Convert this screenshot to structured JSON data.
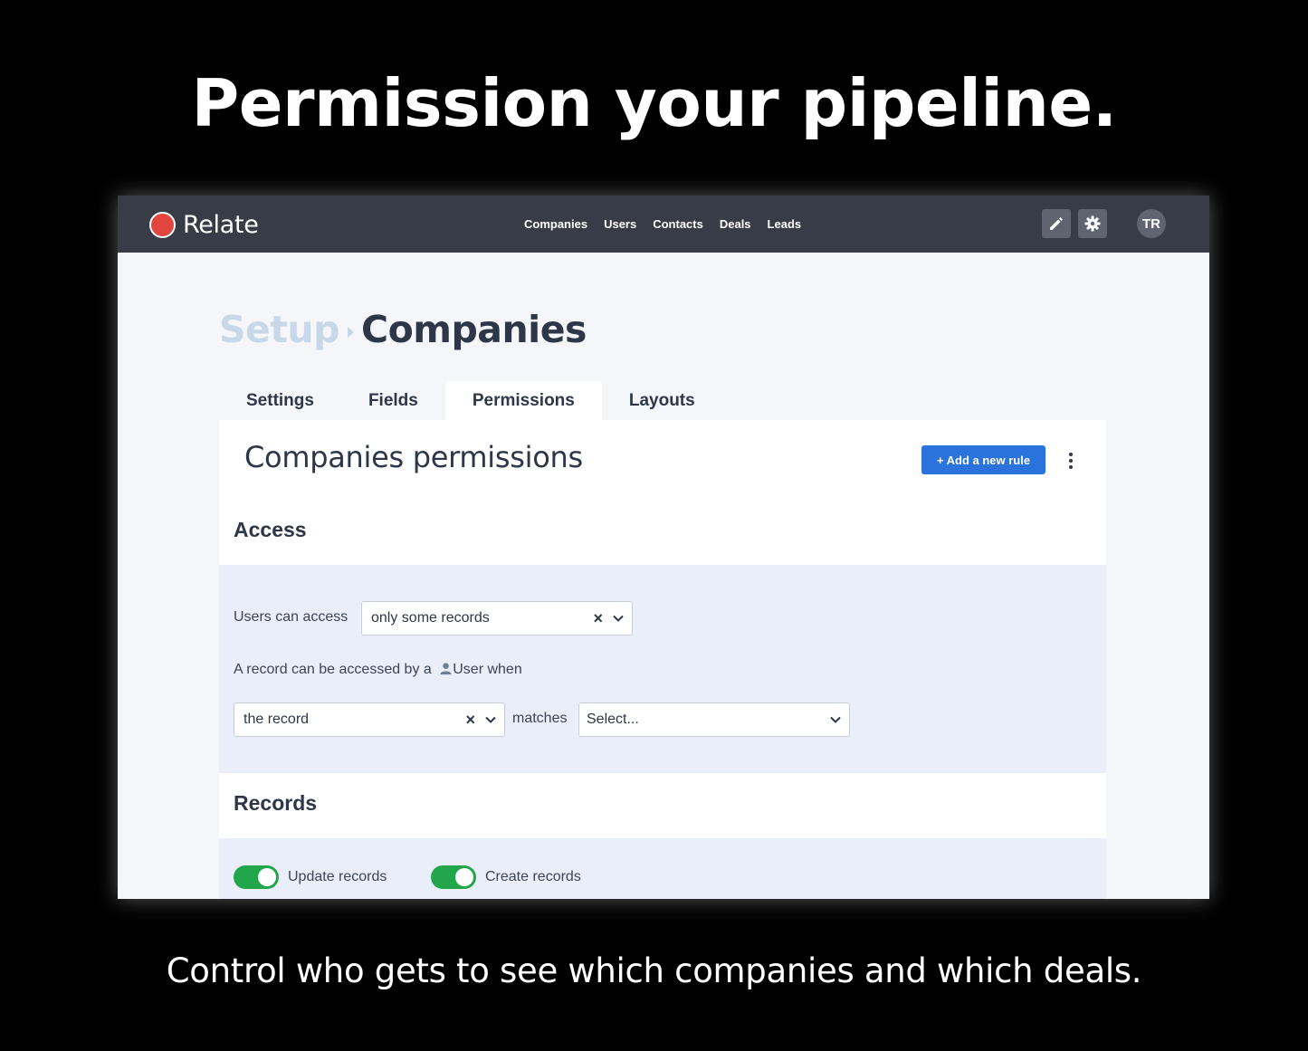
{
  "headline": "Permission your pipeline.",
  "subline": "Control who gets to see which companies and which deals.",
  "app": {
    "name": "Relate",
    "nav": [
      "Companies",
      "Users",
      "Contacts",
      "Deals",
      "Leads"
    ],
    "avatar_initials": "TR",
    "icons": [
      "pencil-icon",
      "gear-icon"
    ]
  },
  "breadcrumb": {
    "parent": "Setup",
    "current": "Companies"
  },
  "tabs": [
    {
      "label": "Settings",
      "active": false
    },
    {
      "label": "Fields",
      "active": false
    },
    {
      "label": "Permissions",
      "active": true
    },
    {
      "label": "Layouts",
      "active": false
    }
  ],
  "panel": {
    "title": "Companies permissions",
    "add_rule_label": "+ Add a new rule"
  },
  "access": {
    "title": "Access",
    "users_can_access_label": "Users can access",
    "users_can_access_value": "only some records",
    "accessed_by_prefix": "A record can be accessed by a",
    "accessed_by_entity": "User when",
    "condition_subject": "the record",
    "condition_operator": "matches",
    "condition_target_placeholder": "Select..."
  },
  "records": {
    "title": "Records",
    "toggles": [
      {
        "label": "Update records",
        "on": true
      },
      {
        "label": "Create records",
        "on": true
      }
    ]
  },
  "colors": {
    "brand_red": "#e1473f",
    "topbar": "#373c47",
    "primary_button": "#2a73dd",
    "toggle_on": "#21a64b"
  }
}
